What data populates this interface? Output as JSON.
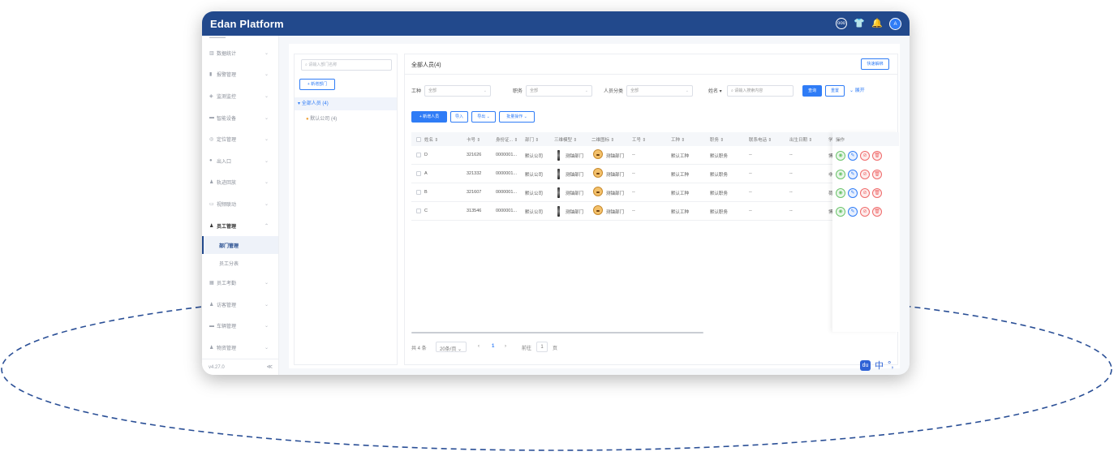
{
  "app": {
    "title": "Edan Platform",
    "avatar_label": "A"
  },
  "top_icons": [
    "info-circle-icon",
    "shirt-icon",
    "bell-icon"
  ],
  "sidebar": {
    "items": [
      {
        "label": "数据统计",
        "icon": "chart-icon",
        "open": false
      },
      {
        "label": "报警管理",
        "icon": "trash-icon",
        "open": false
      },
      {
        "label": "监测监控",
        "icon": "shield-icon",
        "open": false
      },
      {
        "label": "智能设备",
        "icon": "device-icon",
        "open": false
      },
      {
        "label": "定位管理",
        "icon": "locate-icon",
        "open": false
      },
      {
        "label": "出入口",
        "icon": "globe-icon",
        "open": false
      },
      {
        "label": "轨迹回放",
        "icon": "person-pin-icon",
        "open": false
      },
      {
        "label": "视频联动",
        "icon": "camera-icon",
        "open": false
      },
      {
        "label": "员工管理",
        "icon": "user-icon",
        "open": true
      }
    ],
    "subitems": [
      {
        "label": "部门管理",
        "active": true
      },
      {
        "label": "员工分表",
        "active": false
      }
    ],
    "items_after": [
      {
        "label": "员工考勤",
        "icon": "calendar-icon"
      },
      {
        "label": "访客管理",
        "icon": "visitor-icon"
      },
      {
        "label": "车辆管理",
        "icon": "car-icon"
      },
      {
        "label": "物资管理",
        "icon": "box-icon"
      }
    ],
    "version": "v4.27.0",
    "collapse": "≪"
  },
  "tree": {
    "search_placeholder": "请输入部门名称",
    "new_dept_label": "+ 新增部门",
    "root": "全部人员 (4)",
    "child": "默认公司 (4)"
  },
  "main": {
    "title": "全部人员(4)",
    "quick_btn": "快速解绑",
    "filters": {
      "worktype_label": "工种",
      "worktype_value": "全部",
      "position_label": "职务",
      "position_value": "全部",
      "category_label": "人员分类",
      "category_value": "全部",
      "name_label": "姓名 ▾",
      "name_placeholder": "请输入搜索内容",
      "search_btn": "查询",
      "reset_btn": "重置",
      "expand": "展开"
    },
    "actions": {
      "add": "+ 新增人员",
      "import": "导入",
      "export": "导出 ⌄",
      "batch": "批量操作 ⌄"
    },
    "columns": [
      "姓名 ⇕",
      "卡号 ⇕",
      "身份证... ⇕",
      "部门 ⇕",
      "三维模型 ⇕",
      "二维图标 ⇕",
      "工号 ⇕",
      "工种 ⇕",
      "职务 ⇕",
      "联系电话 ⇕",
      "出生日期 ⇕",
      "学"
    ],
    "ops_header": "操作",
    "rows": [
      {
        "name": "D",
        "card": "321626",
        "id": "0000001...",
        "dept": "默认公司",
        "model": "测铀部门",
        "icon": "测铀部门",
        "no": "--",
        "worktype": "默认工种",
        "position": "默认职务",
        "phone": "--",
        "birth": "--",
        "edu": "博"
      },
      {
        "name": "A",
        "card": "321332",
        "id": "0000001...",
        "dept": "默认公司",
        "model": "测铀部门",
        "icon": "测铀部门",
        "no": "--",
        "worktype": "默认工种",
        "position": "默认职务",
        "phone": "--",
        "birth": "--",
        "edu": "非"
      },
      {
        "name": "B",
        "card": "321607",
        "id": "0000001...",
        "dept": "默认公司",
        "model": "测铀部门",
        "icon": "测铀部门",
        "no": "--",
        "worktype": "默认工种",
        "position": "默认职务",
        "phone": "--",
        "birth": "--",
        "edu": "荷"
      },
      {
        "name": "C",
        "card": "313546",
        "id": "0000001...",
        "dept": "默认公司",
        "model": "测铀部门",
        "icon": "测铀部门",
        "no": "--",
        "worktype": "默认工种",
        "position": "默认职务",
        "phone": "--",
        "birth": "--",
        "edu": "博"
      }
    ],
    "pager": {
      "total": "共 4 条",
      "size": "20条/页 ⌄",
      "prev": "‹",
      "page": "1",
      "next": "›",
      "goto_label": "前往",
      "goto_value": "1",
      "goto_suffix": "页"
    }
  },
  "ime": {
    "du": "du",
    "lang": "中",
    "punct": "°,"
  }
}
